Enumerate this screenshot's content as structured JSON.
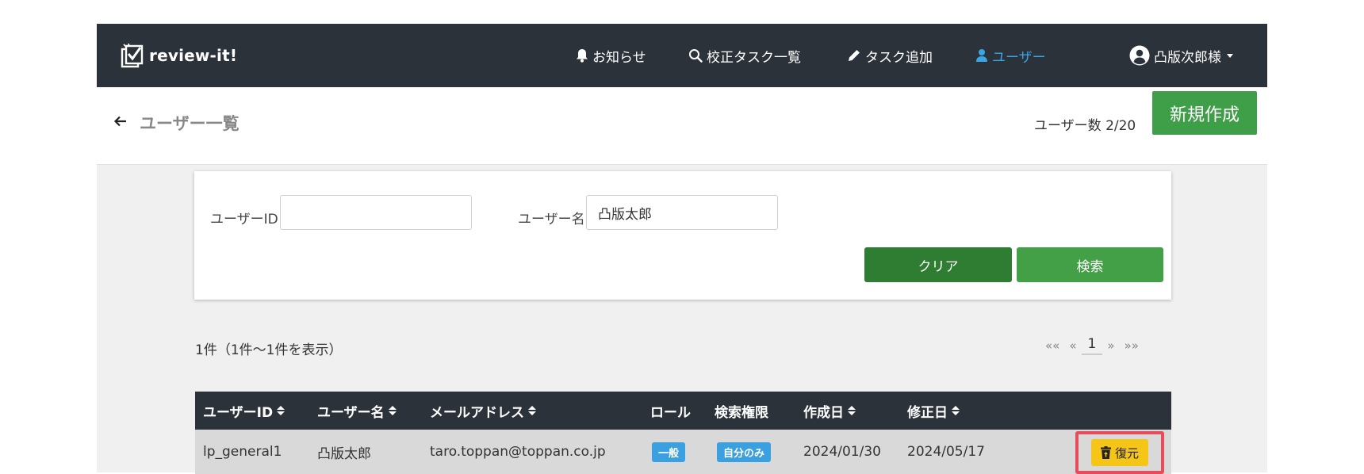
{
  "navbar": {
    "brand": "review-it!",
    "items": [
      {
        "label": "お知らせ",
        "icon": "bell-icon"
      },
      {
        "label": "校正タスク一覧",
        "icon": "search-icon"
      },
      {
        "label": "タスク追加",
        "icon": "pencil-icon"
      },
      {
        "label": "ユーザー",
        "icon": "user-icon",
        "active": true
      }
    ],
    "account": {
      "label": "凸版次郎様",
      "icon": "user-circle-icon"
    },
    "colors": {
      "background": "#2c323a",
      "active": "#3aa6e6"
    }
  },
  "subheader": {
    "title": "ユーザー一覧",
    "user_count": "ユーザー数 2/20",
    "new_button": "新規作成"
  },
  "search": {
    "user_id_label": "ユーザーID",
    "user_id_value": "",
    "user_name_label": "ユーザー名",
    "user_name_value": "凸版太郎",
    "clear_button": "クリア",
    "search_button": "検索"
  },
  "results": {
    "summary": "1件（1件〜1件を表示）",
    "pagination": {
      "first": "««",
      "prev": "«",
      "current": "1",
      "next": "»",
      "last": "»»"
    },
    "columns": [
      "ユーザーID",
      "ユーザー名",
      "メールアドレス",
      "ロール",
      "検索権限",
      "作成日",
      "修正日"
    ],
    "rows": [
      {
        "user_id": "lp_general1",
        "user_name": "凸版太郎",
        "email": "taro.toppan@toppan.co.jp",
        "role": "一般",
        "search_permission": "自分のみ",
        "created": "2024/01/30",
        "modified": "2024/05/17",
        "action": "復元"
      }
    ]
  }
}
